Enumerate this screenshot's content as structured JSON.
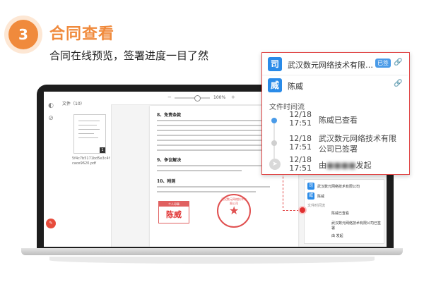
{
  "step": {
    "number": "3",
    "title": "合同查看",
    "subtitle": "合同在线预览，签署进度一目了然"
  },
  "colors": {
    "accent": "#f08a3c",
    "brand_blue": "#2a8be8",
    "highlight_red": "#e04848"
  },
  "app": {
    "file_panel_title": "文件（10）",
    "file_name": "5f4c7b5171bd5e3c4fcace9620.pdf",
    "zoom": "100%",
    "sections": [
      "8、免责条款",
      "9、争议解决",
      "10、附则"
    ],
    "person_stamp_header": "个人印章",
    "person_stamp_name": "陈威",
    "company_seal_text": "武汉数元网络技术有限公司",
    "sidebar_mini": {
      "company": "武汉数元网络技术有限公司",
      "person": "陈威",
      "flow_title": "文件时间流",
      "events": [
        {
          "date": "12/18",
          "time": "17:51",
          "text": "陈威已查看"
        },
        {
          "date": "12/18",
          "time": "17:51",
          "text": "武汉数元网络技术有限公司已签署"
        },
        {
          "date": "12/18",
          "time": "17:51",
          "text": "由 发起"
        }
      ]
    }
  },
  "popup": {
    "signer_company": {
      "avatar": "司",
      "name": "武汉数元网络技术有限…",
      "tag": "已签"
    },
    "signer_person": {
      "avatar": "威",
      "name": "陈威"
    },
    "flow_title": "文件时间流",
    "events": [
      {
        "date": "12/18",
        "time": "17:51",
        "text": "陈威已查看"
      },
      {
        "date": "12/18",
        "time": "17:51",
        "text": "武汉数元网络技术有限公司已签署"
      },
      {
        "date": "12/18",
        "time": "17:51",
        "text": "由",
        "suffix": "发起"
      }
    ]
  }
}
